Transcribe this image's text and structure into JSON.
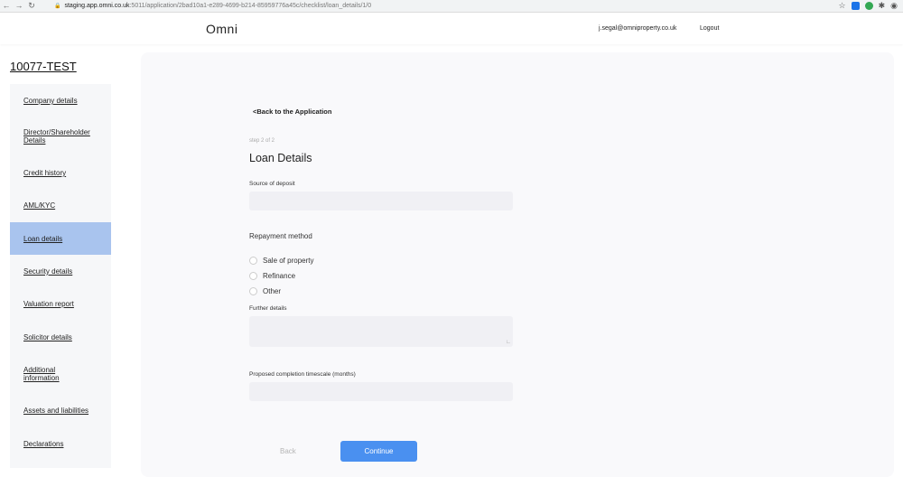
{
  "browser": {
    "url_host": "staging.app.omni.co.uk",
    "url_path": ":5011/application/2bad10a1-e289-4699-b214-85959776a45c/checklist/loan_details/1/0",
    "ext_colors": [
      "#1a73e8",
      "#34a853",
      "#555555"
    ]
  },
  "header": {
    "logo": "Omni",
    "user_email": "j.segal@omniproperty.co.uk",
    "logout": "Logout"
  },
  "application_id": "10077-TEST",
  "sidebar": {
    "items": [
      {
        "label": "Company details"
      },
      {
        "label": "Director/Shareholder Details"
      },
      {
        "label": "Credit history"
      },
      {
        "label": "AML/KYC"
      },
      {
        "label": "Loan details",
        "active": true
      },
      {
        "label": "Security details"
      },
      {
        "label": "Valuation report"
      },
      {
        "label": "Solicitor details"
      },
      {
        "label": "Additional information"
      },
      {
        "label": "Assets and liabilities"
      },
      {
        "label": "Declarations"
      }
    ]
  },
  "form": {
    "back_link": "<Back to the Application",
    "step": "step 2 of 2",
    "title": "Loan Details",
    "source_of_deposit": {
      "label": "Source of deposit",
      "value": ""
    },
    "repayment_method": {
      "heading": "Repayment method",
      "options": [
        "Sale of property",
        "Refinance",
        "Other"
      ]
    },
    "further_details": {
      "label": "Further details",
      "value": ""
    },
    "completion_timescale": {
      "label": "Proposed completion timescale (months)",
      "value": ""
    },
    "back_button": "Back",
    "continue_button": "Continue"
  },
  "colors": {
    "accent": "#4a90f0",
    "active_nav": "#a9c4ee"
  }
}
